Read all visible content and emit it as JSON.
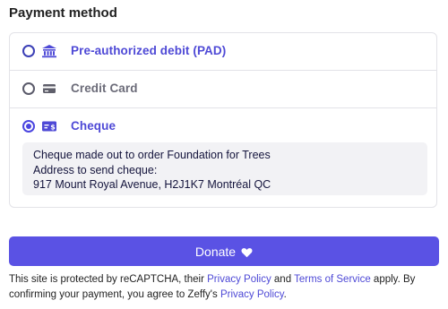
{
  "section": {
    "title": "Payment method"
  },
  "options": [
    {
      "label": "Pre-authorized debit (PAD)",
      "icon": "bank-icon",
      "selected": false
    },
    {
      "label": "Credit Card",
      "icon": "credit-card-icon",
      "selected": false
    },
    {
      "label": "Cheque",
      "icon": "cheque-icon",
      "selected": true
    }
  ],
  "cheque_info": {
    "line1": "Cheque made out to order Foundation for Trees",
    "line2": "Address to send cheque:",
    "line3": "917 Mount Royal Avenue, H2J1K7 Montréal QC"
  },
  "donate_button": {
    "label": "Donate",
    "icon": "heart-icon"
  },
  "footer": {
    "text1": "This site is protected by reCAPTCHA, their ",
    "privacy_link": "Privacy Policy",
    "text2": " and ",
    "terms_link": "Terms of Service",
    "text3": " apply. By confirming your payment, you agree to Zeffy's ",
    "zeffy_privacy_link": "Privacy Policy",
    "text4": "."
  },
  "colors": {
    "accent": "#4e49d6",
    "button": "#5a52e4",
    "muted": "#6b6b78"
  }
}
